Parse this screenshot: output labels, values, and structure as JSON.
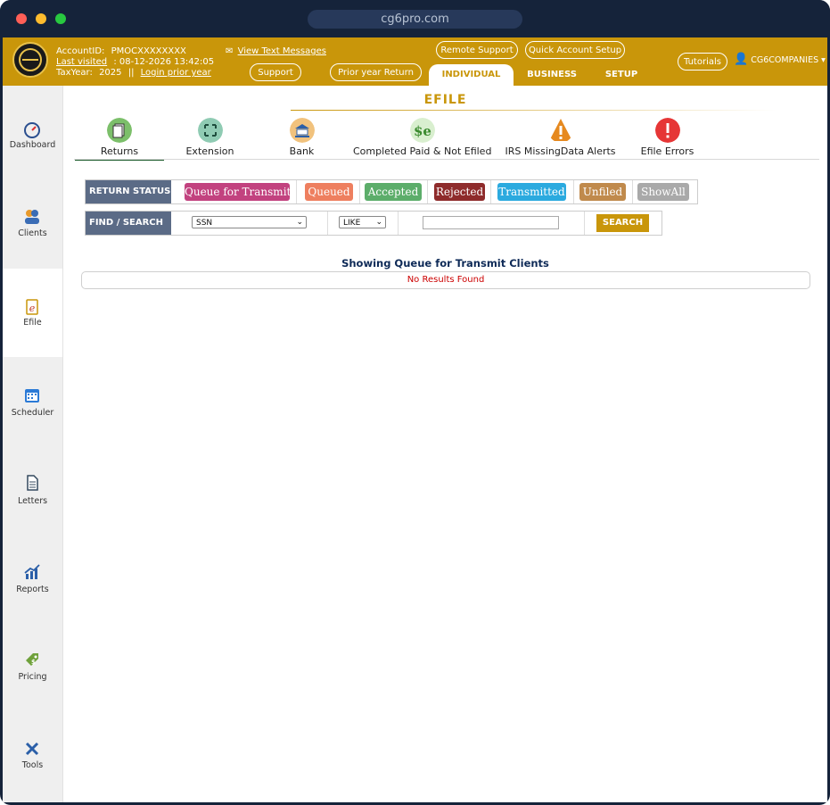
{
  "browser": {
    "url": "cg6pro.com"
  },
  "header": {
    "account_id_label": "AccountID:",
    "account_id": "PMOCXXXXXXXX",
    "last_visited_label": "Last visited",
    "last_visited": ": 08-12-2026 13:42:05",
    "taxyear_label": "TaxYear:",
    "taxyear": "2025",
    "taxyear_sep": "||",
    "login_prior": "Login prior year",
    "view_text": "View Text Messages",
    "remote_support": "Remote Support",
    "quick_setup": "Quick Account Setup",
    "support": "Support",
    "prior_year_return": "Prior year Return",
    "tutorials": "Tutorials",
    "user": "CG6COMPANIES",
    "tabs": [
      "INDIVIDUAL",
      "BUSINESS",
      "SETUP"
    ]
  },
  "sidebar": {
    "items": [
      {
        "label": "Dashboard",
        "icon": "gauge-icon"
      },
      {
        "label": "Clients",
        "icon": "users-icon"
      },
      {
        "label": "Efile",
        "icon": "efile-icon"
      },
      {
        "label": "Scheduler",
        "icon": "calendar-icon"
      },
      {
        "label": "Letters",
        "icon": "document-icon"
      },
      {
        "label": "Reports",
        "icon": "chart-icon"
      },
      {
        "label": "Pricing",
        "icon": "price-tag-icon"
      },
      {
        "label": "Tools",
        "icon": "tools-icon"
      }
    ]
  },
  "main": {
    "title": "EFILE",
    "subtabs": [
      {
        "label": "Returns",
        "icon": "returns-icon"
      },
      {
        "label": "Extension",
        "icon": "extension-icon"
      },
      {
        "label": "Bank",
        "icon": "bank-icon"
      },
      {
        "label": "Completed Paid & Not Efiled",
        "icon": "dollar-e-icon"
      },
      {
        "label": "IRS MissingData Alerts",
        "icon": "warning-icon"
      },
      {
        "label": "Efile Errors",
        "icon": "error-icon"
      }
    ],
    "return_status_label": "RETURN STATUS",
    "status_buttons": [
      {
        "label": "Queue for Transmit",
        "color": "#c2427f"
      },
      {
        "label": "Queued",
        "color": "#ee7f5f"
      },
      {
        "label": "Accepted",
        "color": "#5cad6a"
      },
      {
        "label": "Rejected",
        "color": "#8e2b2b"
      },
      {
        "label": "Transmitted",
        "color": "#2baadf"
      },
      {
        "label": "Unfiled",
        "color": "#c08a4c"
      },
      {
        "label": "ShowAll",
        "color": "#a9a9a9"
      }
    ],
    "find_label": "FIND / SEARCH",
    "search_field": "SSN",
    "search_operator": "LIKE",
    "search_value": "",
    "search_button": "SEARCH",
    "showing": "Showing Queue for Transmit Clients",
    "no_results": "No Results Found"
  },
  "colors": {
    "brand": "#c9960a",
    "frame": "#15233a",
    "header_text": "#ffffff"
  }
}
